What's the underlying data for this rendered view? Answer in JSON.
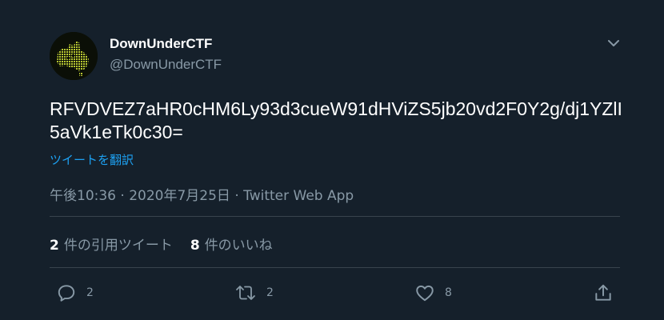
{
  "author": {
    "display_name": "DownUnderCTF",
    "handle": "@DownUnderCTF",
    "avatar_icon": "australia-map-icon"
  },
  "tweet": {
    "text": "RFVDVEZ7aHR0cHM6Ly93d3cueW91dHViZS5jb20vd2F0Y2g/dj1YZlI5aVk1eTk0c30=",
    "translate_label": "ツイートを翻訳",
    "time": "午後10:36",
    "separator": "·",
    "date": "2020年7月25日",
    "source": "Twitter Web App"
  },
  "stats": [
    {
      "count": "2",
      "label": "件の引用ツイート"
    },
    {
      "count": "8",
      "label": "件のいいね"
    }
  ],
  "actions": {
    "reply": {
      "icon": "reply-icon",
      "count": "2"
    },
    "retweet": {
      "icon": "retweet-icon",
      "count": "2"
    },
    "like": {
      "icon": "heart-icon",
      "count": "8"
    },
    "share": {
      "icon": "share-icon"
    }
  },
  "colors": {
    "background": "#15202b",
    "text": "#ffffff",
    "secondary": "#8899a6",
    "accent": "#1da1f2",
    "divider": "#38444d"
  }
}
